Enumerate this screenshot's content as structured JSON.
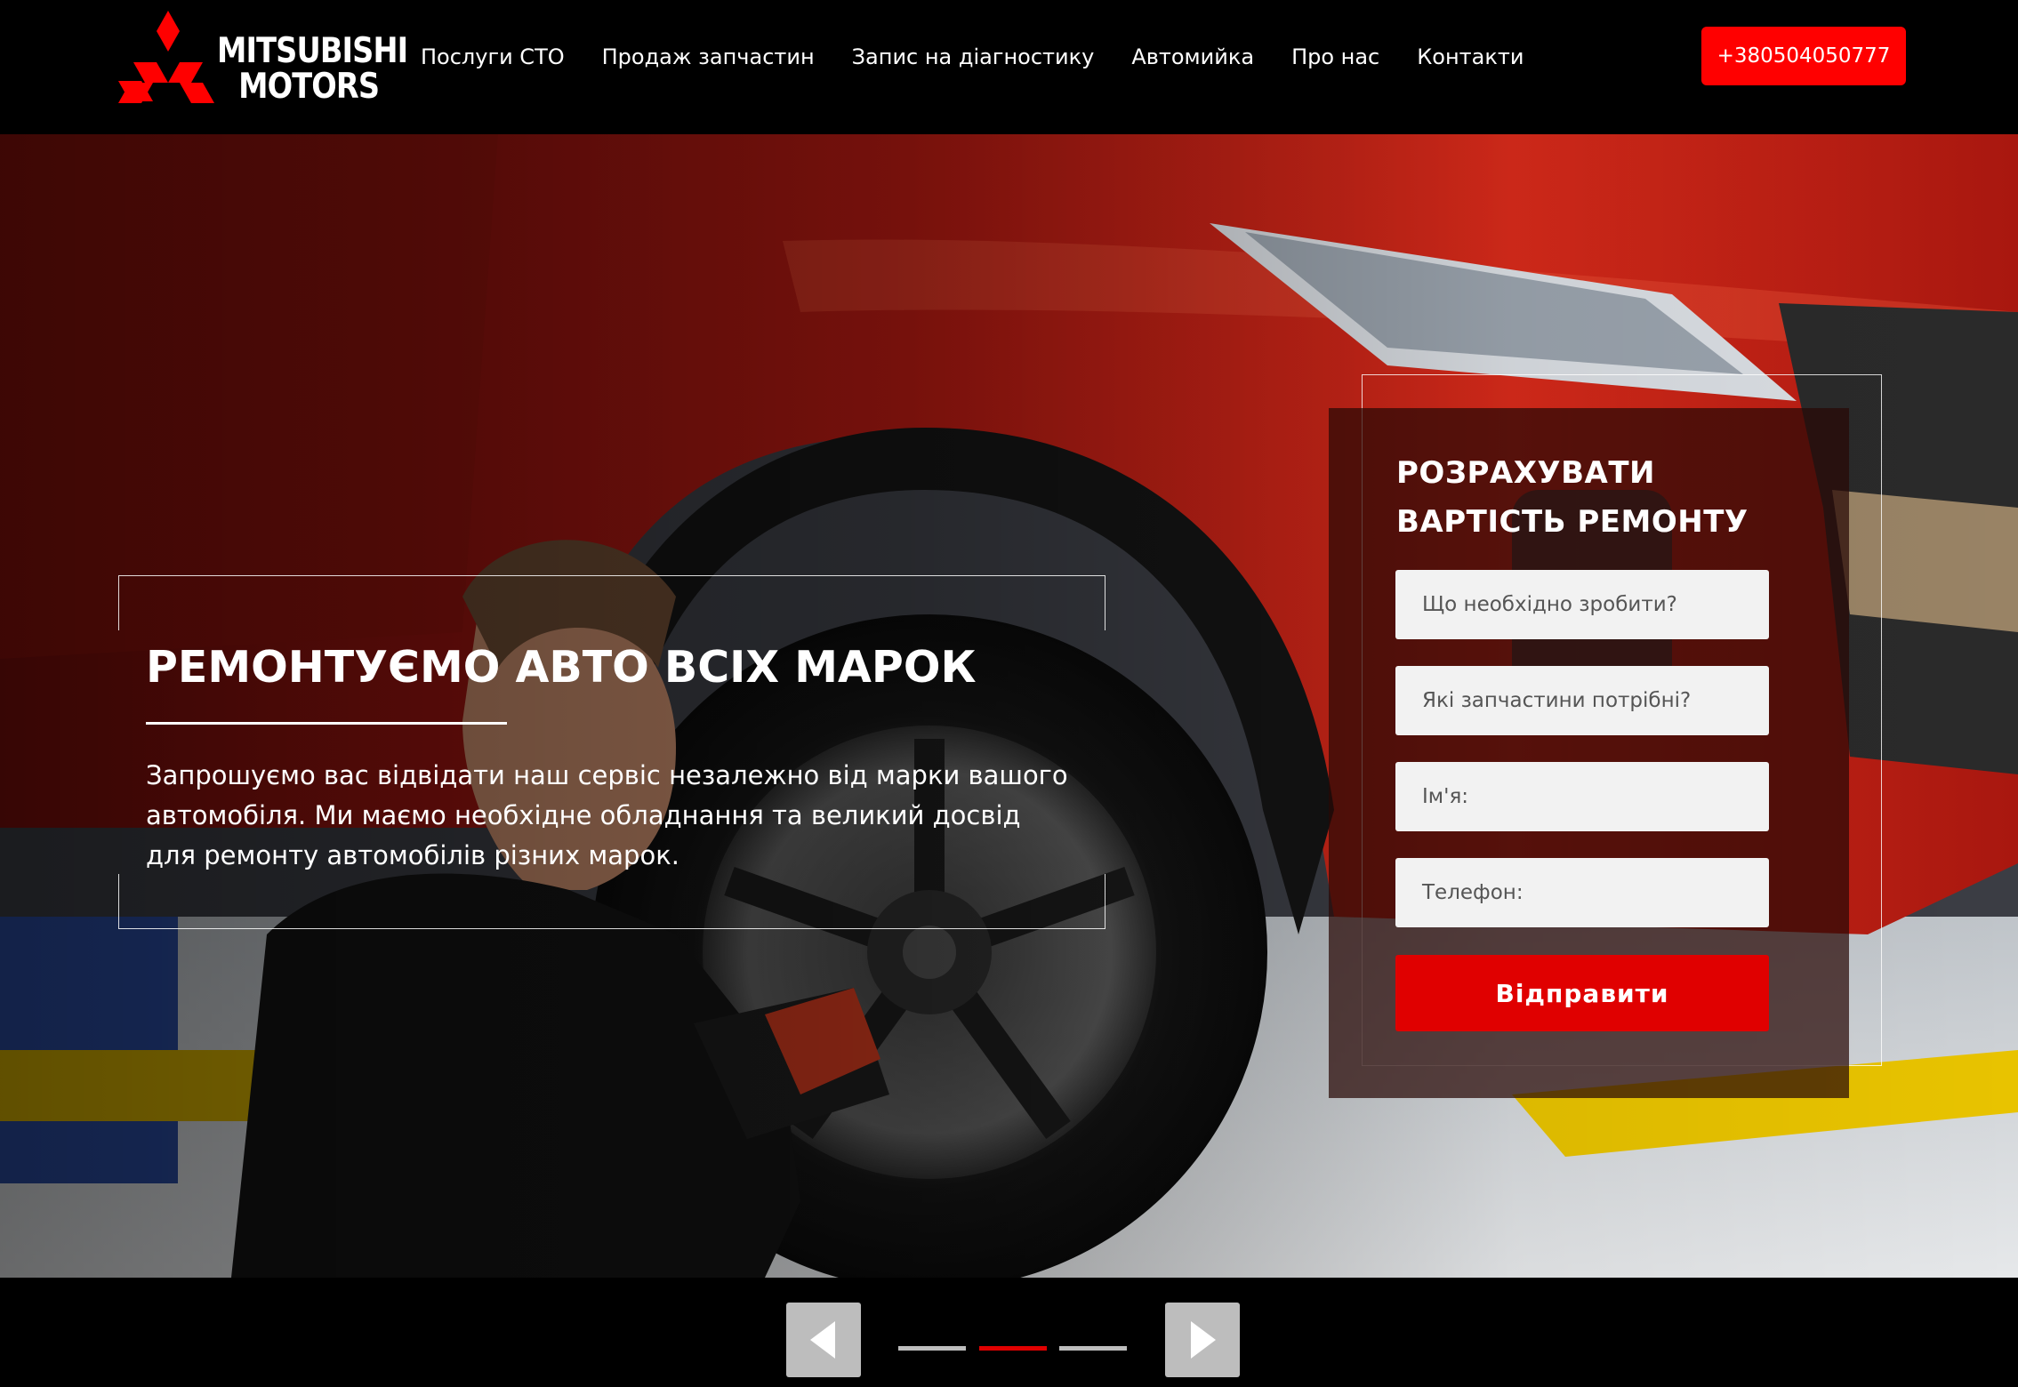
{
  "brand": {
    "line1": "MITSUBISHI",
    "line2": "MOTORS",
    "logo_color": "#ff0000"
  },
  "nav": {
    "items": [
      {
        "label": "Послуги СТО"
      },
      {
        "label": "Продаж запчастин"
      },
      {
        "label": "Запис на діагностику"
      },
      {
        "label": "Автомийка"
      },
      {
        "label": "Про нас"
      },
      {
        "label": "Контакти"
      }
    ],
    "phone": "+380504050777"
  },
  "hero": {
    "title": "РЕМОНТУЄМО АВТО ВСІХ МАРОК",
    "text": "Запрошуємо вас відвідати наш сервіс незалежно від марки вашого автомобіля. Ми маємо необхідне обладнання та великий досвід для ремонту автомобілів різних марок."
  },
  "form": {
    "title": "РОЗРАХУВАТИ ВАРТІСТЬ РЕМОНТУ",
    "fields": [
      {
        "placeholder": "Що необхідно зробити?"
      },
      {
        "placeholder": "Які запчастини потрібні?"
      },
      {
        "placeholder": "Ім'я:"
      },
      {
        "placeholder": "Телефон:"
      }
    ],
    "submit_label": "Відправити"
  },
  "slider": {
    "prev_icon": "triangle-left-icon",
    "next_icon": "triangle-right-icon",
    "slides": 3,
    "active_index": 1,
    "accent_color": "#e00000"
  }
}
